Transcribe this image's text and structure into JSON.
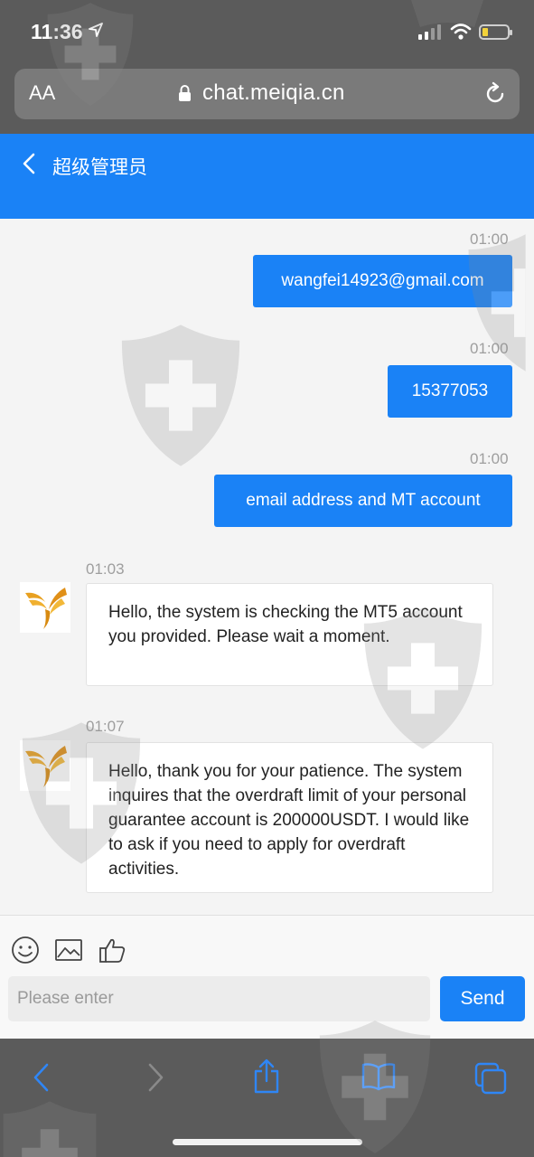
{
  "status_bar": {
    "time": "11:36"
  },
  "address_bar": {
    "text_size_label": "AA",
    "url": "chat.meiqia.cn"
  },
  "chat_header": {
    "title": "超级管理员"
  },
  "messages": [
    {
      "direction": "out",
      "time": "01:00",
      "text": "wangfei14923@gmail.com"
    },
    {
      "direction": "out",
      "time": "01:00",
      "text": "15377053"
    },
    {
      "direction": "out",
      "time": "01:00",
      "text": "email address and MT account"
    },
    {
      "direction": "in",
      "time": "01:03",
      "text": "Hello, the system is checking the MT5 account you provided. Please wait a moment."
    },
    {
      "direction": "in",
      "time": "01:07",
      "text": "Hello, thank you for your patience. The system inquires that the overdraft limit of your personal guarantee account is 200000USDT. I would like to ask if you need to apply for overdraft activities."
    }
  ],
  "composer": {
    "placeholder": "Please enter",
    "send_label": "Send",
    "tools": [
      "smiley-icon",
      "image-icon",
      "thumbs-up-icon"
    ]
  },
  "bottom_toolbar": {
    "icons": [
      "back-arrow-icon",
      "forward-arrow-icon",
      "share-icon",
      "bookmarks-icon",
      "tabs-icon"
    ]
  },
  "colors": {
    "accent": "#1a82f6",
    "chrome": "#5b5b5b",
    "chat_bg": "#f4f4f4",
    "watermark": "#8a8a8a"
  }
}
